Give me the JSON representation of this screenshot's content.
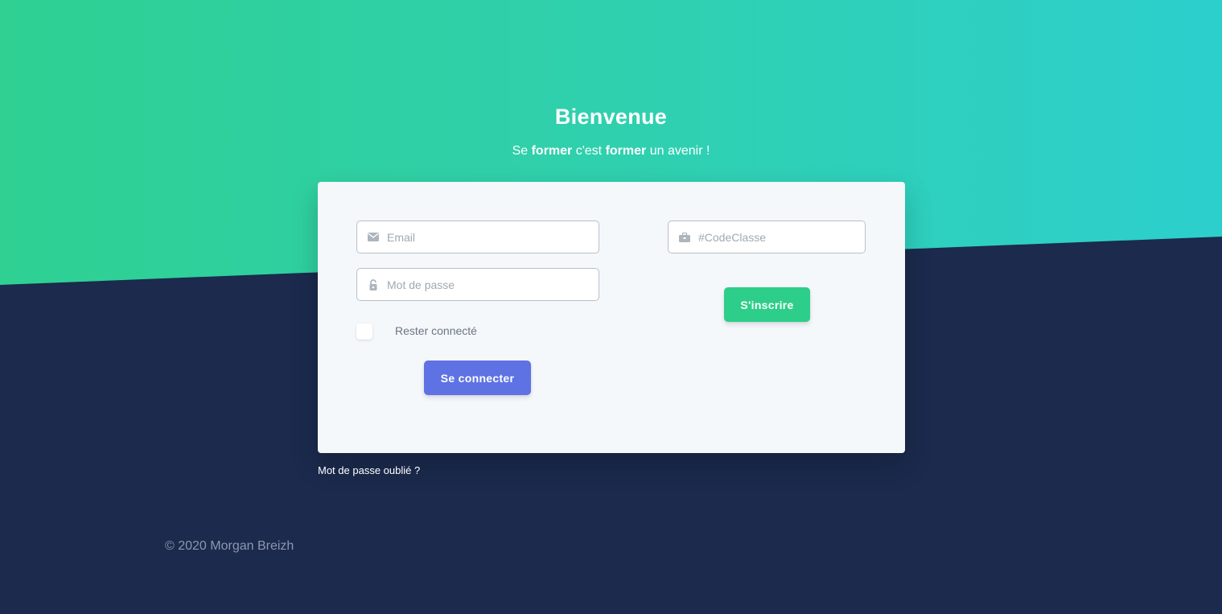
{
  "hero": {
    "title": "Bienvenue",
    "subtitle_parts": [
      "Se ",
      "former",
      " c'est ",
      "former",
      " un avenir !"
    ]
  },
  "login_form": {
    "email_placeholder": "Email",
    "email_icon": "envelope-icon",
    "password_placeholder": "Mot de passe",
    "password_icon": "lock-icon",
    "remember_label": "Rester connecté",
    "remember_checked": false,
    "submit_label": "Se connecter"
  },
  "register_form": {
    "code_placeholder": "#CodeClasse",
    "code_icon": "briefcase-icon",
    "submit_label": "S'inscrire"
  },
  "links": {
    "forgot_password": "Mot de passe oublié ?"
  },
  "footer": {
    "copyright": "© 2020 Morgan Breizh"
  },
  "colors": {
    "gradient_start": "#2fd092",
    "gradient_end": "#2dcfcd",
    "background_dark": "#1b2a4d",
    "card_bg": "#f5f8fb",
    "primary_button": "#5e72e4",
    "success_button": "#2dce89"
  }
}
